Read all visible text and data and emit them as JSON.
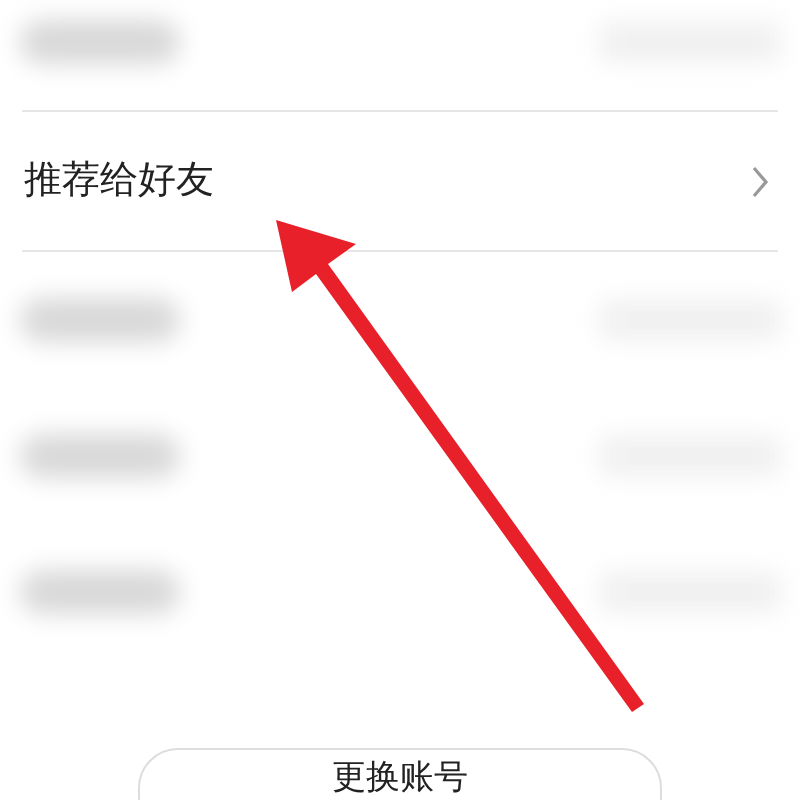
{
  "menu": [
    {
      "kind": "blurred"
    },
    {
      "kind": "link",
      "label": "推荐给好友"
    },
    {
      "kind": "blurred"
    },
    {
      "kind": "blurred"
    },
    {
      "kind": "blurred"
    }
  ],
  "annotation": {
    "kind": "arrow"
  },
  "bottom_button": {
    "label": "更换账号"
  }
}
